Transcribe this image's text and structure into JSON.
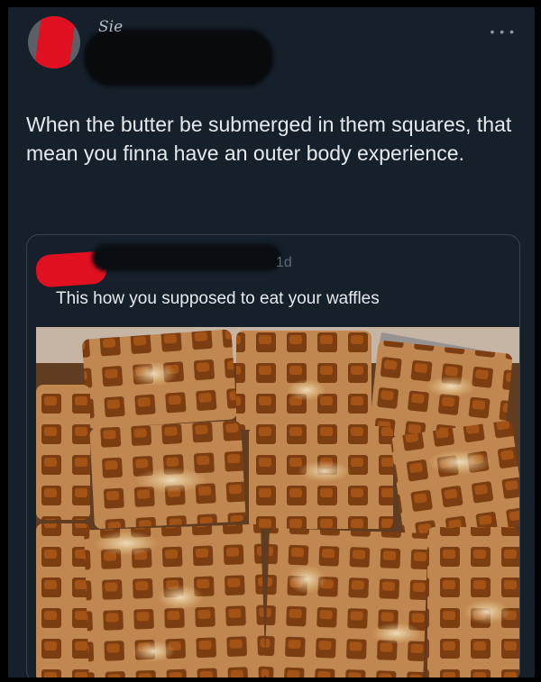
{
  "tweet": {
    "author_partial": "Sie",
    "more_icon": "more-horizontal-icon",
    "text": "When the butter be submerged in them squares, that mean you finna have an outer body experience."
  },
  "quoted": {
    "time": "1d",
    "text": "This how you supposed to eat your waffles",
    "photo_icon": "waffles-photo"
  },
  "colors": {
    "background": "#15202b",
    "text": "#e7e9ea",
    "border": "#38444d",
    "redaction": "#e01020"
  }
}
